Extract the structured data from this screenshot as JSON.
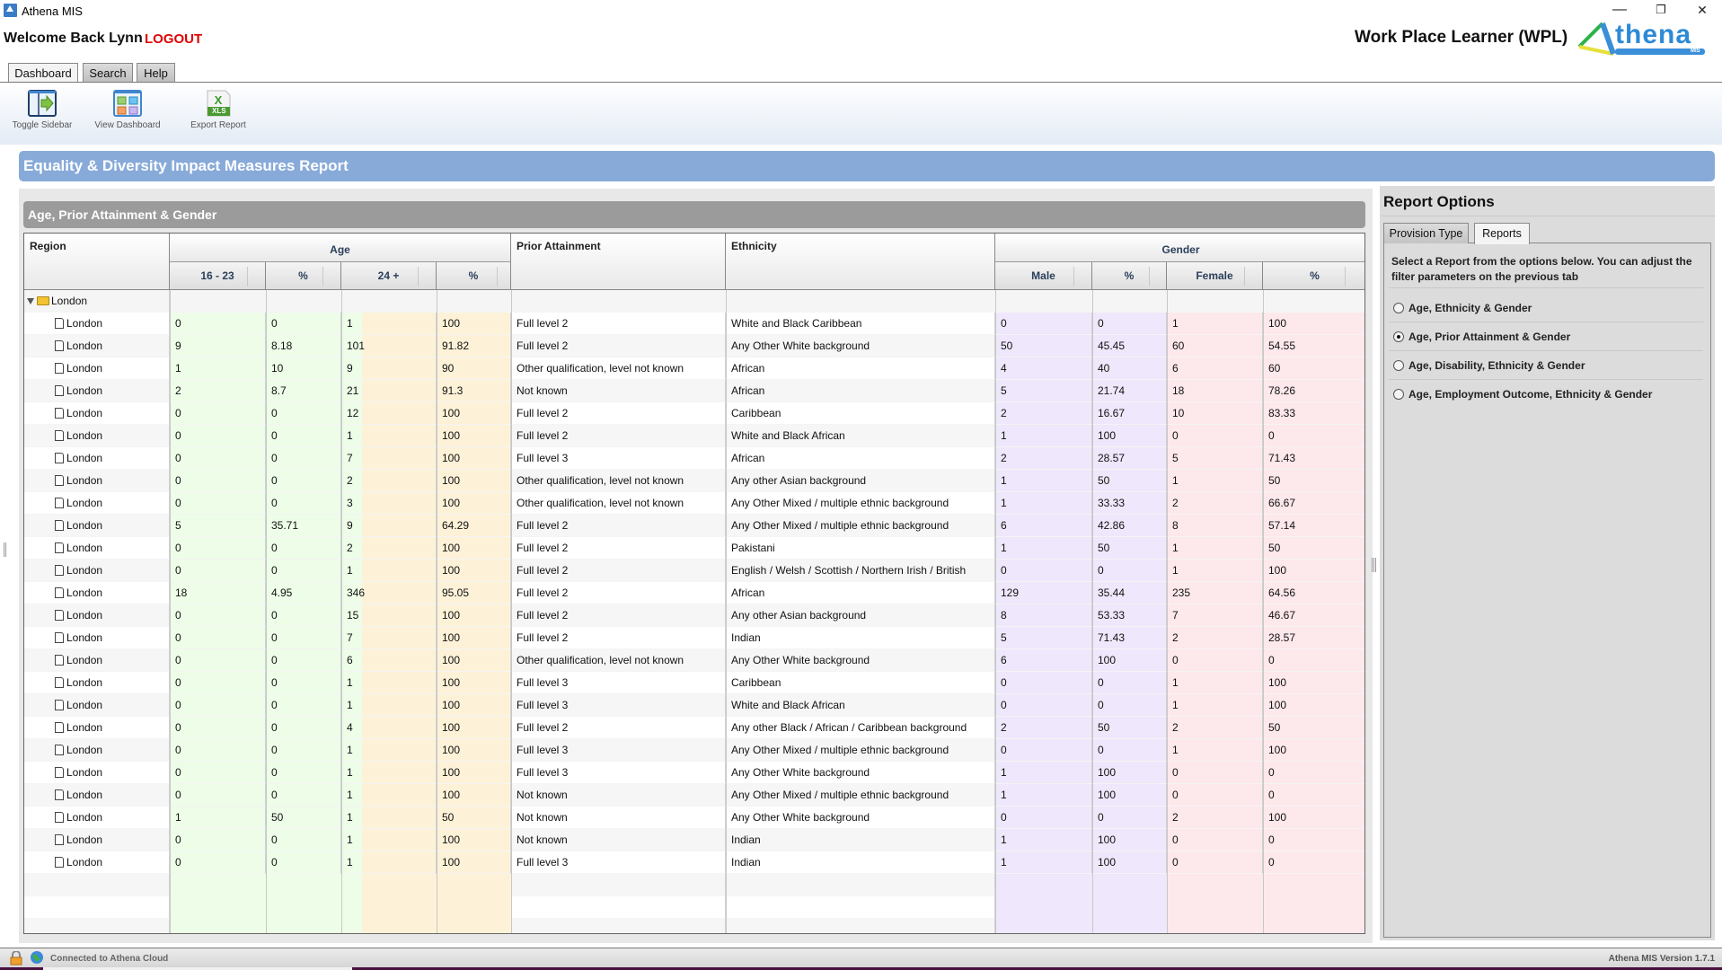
{
  "window": {
    "title": "Athena MIS",
    "controls": {
      "minimize": "—",
      "restore": "❐",
      "close": "✕"
    }
  },
  "header": {
    "welcome": "Welcome Back Lynn",
    "logout": "LOGOUT",
    "module_title": "Work Place Learner (WPL)",
    "logo_text": "thena",
    "logo_sub": "MIS"
  },
  "tabs": [
    {
      "label": "Dashboard",
      "active": true
    },
    {
      "label": "Search",
      "active": false
    },
    {
      "label": "Help",
      "active": false
    }
  ],
  "toolbar": {
    "toggle_sidebar": "Toggle Sidebar",
    "view_dashboard": "View Dashboard",
    "export_report": "Export Report",
    "xls_label": "XLS"
  },
  "report": {
    "title": "Equality & Diversity Impact Measures Report",
    "section_title": "Age, Prior Attainment & Gender"
  },
  "grid": {
    "headers": {
      "region": "Region",
      "age": "Age",
      "age_16_23": "16 - 23",
      "age_16_23_pct": "%",
      "age_24_plus": "24 +",
      "age_24_plus_pct": "%",
      "prior_attainment": "Prior Attainment",
      "ethnicity": "Ethnicity",
      "gender": "Gender",
      "male": "Male",
      "male_pct": "%",
      "female": "Female",
      "female_pct": "%"
    },
    "group": {
      "label": "London",
      "expanded": true
    },
    "rows": [
      [
        "London",
        "0",
        "0",
        "1",
        "100",
        "Full level 2",
        "White and Black Caribbean",
        "0",
        "0",
        "1",
        "100"
      ],
      [
        "London",
        "9",
        "8.18",
        "101",
        "91.82",
        "Full level 2",
        "Any Other White background",
        "50",
        "45.45",
        "60",
        "54.55"
      ],
      [
        "London",
        "1",
        "10",
        "9",
        "90",
        "Other qualification, level not known",
        "African",
        "4",
        "40",
        "6",
        "60"
      ],
      [
        "London",
        "2",
        "8.7",
        "21",
        "91.3",
        "Not known",
        "African",
        "5",
        "21.74",
        "18",
        "78.26"
      ],
      [
        "London",
        "0",
        "0",
        "12",
        "100",
        "Full level 2",
        "Caribbean",
        "2",
        "16.67",
        "10",
        "83.33"
      ],
      [
        "London",
        "0",
        "0",
        "1",
        "100",
        "Full level 2",
        "White and Black African",
        "1",
        "100",
        "0",
        "0"
      ],
      [
        "London",
        "0",
        "0",
        "7",
        "100",
        "Full level 3",
        "African",
        "2",
        "28.57",
        "5",
        "71.43"
      ],
      [
        "London",
        "0",
        "0",
        "2",
        "100",
        "Other qualification, level not known",
        "Any other Asian background",
        "1",
        "50",
        "1",
        "50"
      ],
      [
        "London",
        "0",
        "0",
        "3",
        "100",
        "Other qualification, level not known",
        "Any Other Mixed / multiple ethnic background",
        "1",
        "33.33",
        "2",
        "66.67"
      ],
      [
        "London",
        "5",
        "35.71",
        "9",
        "64.29",
        "Full level 2",
        "Any Other Mixed / multiple ethnic background",
        "6",
        "42.86",
        "8",
        "57.14"
      ],
      [
        "London",
        "0",
        "0",
        "2",
        "100",
        "Full level 2",
        "Pakistani",
        "1",
        "50",
        "1",
        "50"
      ],
      [
        "London",
        "0",
        "0",
        "1",
        "100",
        "Full level 2",
        "English / Welsh / Scottish / Northern Irish / British",
        "0",
        "0",
        "1",
        "100"
      ],
      [
        "London",
        "18",
        "4.95",
        "346",
        "95.05",
        "Full level 2",
        "African",
        "129",
        "35.44",
        "235",
        "64.56"
      ],
      [
        "London",
        "0",
        "0",
        "15",
        "100",
        "Full level 2",
        "Any other Asian background",
        "8",
        "53.33",
        "7",
        "46.67"
      ],
      [
        "London",
        "0",
        "0",
        "7",
        "100",
        "Full level 2",
        "Indian",
        "5",
        "71.43",
        "2",
        "28.57"
      ],
      [
        "London",
        "0",
        "0",
        "6",
        "100",
        "Other qualification, level not known",
        "Any Other White background",
        "6",
        "100",
        "0",
        "0"
      ],
      [
        "London",
        "0",
        "0",
        "1",
        "100",
        "Full level 3",
        "Caribbean",
        "0",
        "0",
        "1",
        "100"
      ],
      [
        "London",
        "0",
        "0",
        "1",
        "100",
        "Full level 3",
        "White and Black African",
        "0",
        "0",
        "1",
        "100"
      ],
      [
        "London",
        "0",
        "0",
        "4",
        "100",
        "Full level 2",
        "Any other Black / African / Caribbean background",
        "2",
        "50",
        "2",
        "50"
      ],
      [
        "London",
        "0",
        "0",
        "1",
        "100",
        "Full level 3",
        "Any Other Mixed / multiple ethnic background",
        "0",
        "0",
        "1",
        "100"
      ],
      [
        "London",
        "0",
        "0",
        "1",
        "100",
        "Full level 3",
        "Any Other White background",
        "1",
        "100",
        "0",
        "0"
      ],
      [
        "London",
        "0",
        "0",
        "1",
        "100",
        "Not known",
        "Any Other Mixed / multiple ethnic background",
        "1",
        "100",
        "0",
        "0"
      ],
      [
        "London",
        "1",
        "50",
        "1",
        "50",
        "Not known",
        "Any Other White background",
        "0",
        "0",
        "2",
        "100"
      ],
      [
        "London",
        "0",
        "0",
        "1",
        "100",
        "Not known",
        "Indian",
        "1",
        "100",
        "0",
        "0"
      ],
      [
        "London",
        "0",
        "0",
        "1",
        "100",
        "Full level 3",
        "Indian",
        "1",
        "100",
        "0",
        "0"
      ]
    ],
    "column_colors": {
      "age_16_23": "#edfde8",
      "age_24_plus": "#fdf2d8",
      "male": "#efe7fb",
      "female": "#fde8ec"
    }
  },
  "report_options": {
    "title": "Report Options",
    "tabs": [
      {
        "label": "Provision Type",
        "active": false
      },
      {
        "label": "Reports",
        "active": true
      }
    ],
    "description": "Select a Report from the options below. You can adjust the filter parameters on the previous tab",
    "options": [
      {
        "label": "Age, Ethnicity & Gender",
        "selected": false
      },
      {
        "label": "Age, Prior Attainment & Gender",
        "selected": true
      },
      {
        "label": "Age, Disability, Ethnicity & Gender",
        "selected": false
      },
      {
        "label": "Age, Employment Outcome, Ethnicity & Gender",
        "selected": false
      }
    ]
  },
  "status": {
    "connection": "Connected to Athena Cloud",
    "version": "Athena MIS Version 1.7.1"
  },
  "colors": {
    "banner": "#87aad9",
    "section_header": "#9b9b9b",
    "logout": "#e00000"
  }
}
